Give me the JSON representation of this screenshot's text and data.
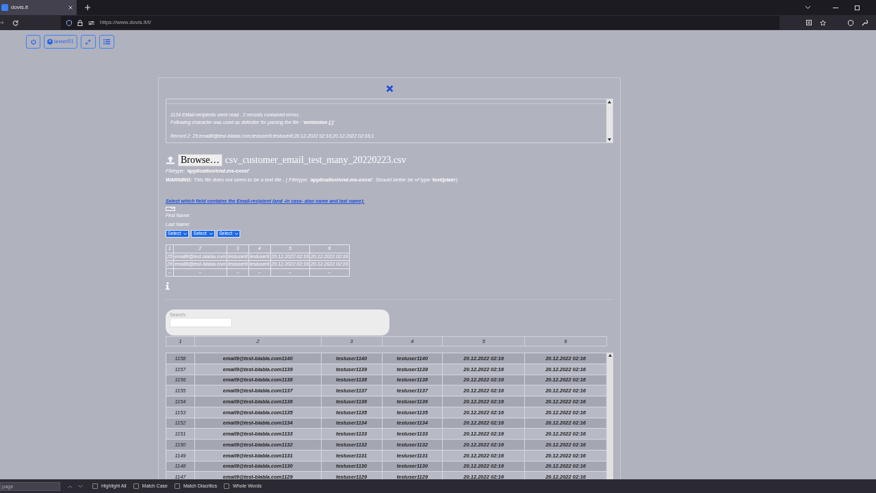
{
  "browser": {
    "tab_title": "dovis.it",
    "url": "https://www.dovis.it/t/"
  },
  "toolbar": {
    "user": "tester01"
  },
  "log": {
    "summary": [
      "1134 EMail-recipients were read . 2 records contained errors .",
      "Following character was used as delimiter for parsing the file : '**semicolon (;)**'"
    ],
    "records": [
      "Record 2: 25;email8@test-blabla.com;testuser8;testuser8;20.12.2022 02:16;20.12.2022 02:16;1"
    ]
  },
  "upload": {
    "button": "Browse…",
    "file_name": "csv_customer_email_test_many_20220223.csv",
    "filetype": "Filetype: '**application/vnd.ms-excel**'",
    "warning": "**WARNING:** This file does not seem to be a text-file . ( Filetype: '**application/vnd.ms-excel**'. Should better be of type '**text/plain**')"
  },
  "mapping": {
    "prompt": "Select which field contains the Email-recipient (and -in case- also name and last name):",
    "labels": [
      "First Name:",
      "Last Name:"
    ],
    "selects": [
      "Select",
      "Select",
      "Select"
    ]
  },
  "preview": {
    "columns": [
      "1",
      "2",
      "3",
      "4",
      "5",
      "6"
    ],
    "rows": [
      [
        "25",
        "email8@test-blabla.com",
        "testuser8",
        "testuser8",
        "20.12.2022 02:16",
        "20.12.2022 02:16"
      ],
      [
        "26",
        "email9@test-blabla.com",
        "testuser9",
        "testuser9",
        "20.12.2022 02:16",
        "20.12.2022 02:16"
      ],
      [
        "–",
        "–",
        "–",
        "–",
        "–",
        "–"
      ]
    ]
  },
  "search": {
    "label": "Search:"
  },
  "table": {
    "columns": [
      "1",
      "2",
      "3",
      "4",
      "5",
      "6"
    ],
    "rows": [
      [
        "1158",
        "email9@test-blabla.com1140",
        "testuser1140",
        "testuser1140",
        "20.12.2022 02:16",
        "20.12.2022 02:16"
      ],
      [
        "1157",
        "email9@test-blabla.com1139",
        "testuser1139",
        "testuser1139",
        "20.12.2022 02:16",
        "20.12.2022 02:16"
      ],
      [
        "1156",
        "email9@test-blabla.com1138",
        "testuser1138",
        "testuser1138",
        "20.12.2022 02:16",
        "20.12.2022 02:16"
      ],
      [
        "1155",
        "email9@test-blabla.com1137",
        "testuser1137",
        "testuser1137",
        "20.12.2022 02:16",
        "20.12.2022 02:16"
      ],
      [
        "1154",
        "email9@test-blabla.com1136",
        "testuser1136",
        "testuser1136",
        "20.12.2022 02:16",
        "20.12.2022 02:16"
      ],
      [
        "1153",
        "email9@test-blabla.com1135",
        "testuser1135",
        "testuser1135",
        "20.12.2022 02:16",
        "20.12.2022 02:16"
      ],
      [
        "1152",
        "email9@test-blabla.com1134",
        "testuser1134",
        "testuser1134",
        "20.12.2022 02:16",
        "20.12.2022 02:16"
      ],
      [
        "1151",
        "email9@test-blabla.com1133",
        "testuser1133",
        "testuser1133",
        "20.12.2022 02:16",
        "20.12.2022 02:16"
      ],
      [
        "1150",
        "email9@test-blabla.com1132",
        "testuser1132",
        "testuser1132",
        "20.12.2022 02:16",
        "20.12.2022 02:16"
      ],
      [
        "1149",
        "email9@test-blabla.com1131",
        "testuser1131",
        "testuser1131",
        "20.12.2022 02:16",
        "20.12.2022 02:16"
      ],
      [
        "1148",
        "email9@test-blabla.com1130",
        "testuser1130",
        "testuser1130",
        "20.12.2022 02:16",
        "20.12.2022 02:16"
      ],
      [
        "1147",
        "email9@test-blabla.com1129",
        "testuser1129",
        "testuser1129",
        "20.12.2022 02:16",
        "20.12.2022 02:16"
      ]
    ]
  },
  "find_bar": {
    "placeholder": "page",
    "options": [
      {
        "label": "Highlight All",
        "checked": false
      },
      {
        "label": "Match Case",
        "checked": false
      },
      {
        "label": "Match Diacritics",
        "checked": false
      },
      {
        "label": "Whole Words",
        "checked": false
      }
    ]
  }
}
